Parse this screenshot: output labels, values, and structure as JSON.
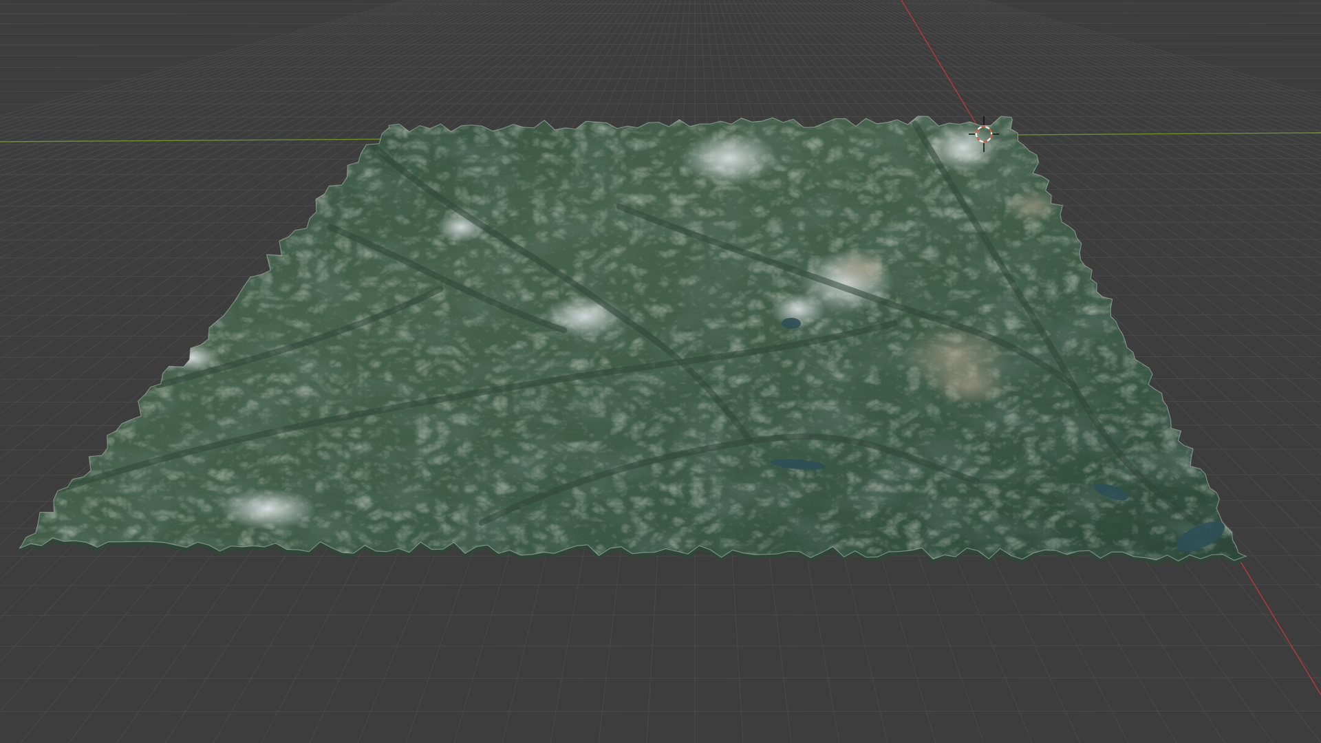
{
  "app": {
    "name": "3D Viewport",
    "editor": "3d-viewport"
  },
  "viewport": {
    "background_color": "#3d3d3d",
    "grid_line_color": "#4a4a4a",
    "grid_major_color": "#525252",
    "axis_x_color": "#b53b3b",
    "axis_y_color": "#6f8f2f"
  },
  "scene": {
    "objects": [
      {
        "name": "terrain-mesh",
        "type": "mesh",
        "shading": "textured",
        "colors": {
          "forest": "#3f5a45",
          "valley": "#2f4638",
          "ridge_light": "#8f9c84",
          "rock": "#9b927c",
          "snow": "#d9dde0",
          "water": "#2e4f57"
        }
      },
      {
        "name": "3d-cursor",
        "type": "cursor",
        "colors": {
          "ring_a": "#e05a3a",
          "ring_b": "#f2f2f2"
        }
      }
    ]
  }
}
